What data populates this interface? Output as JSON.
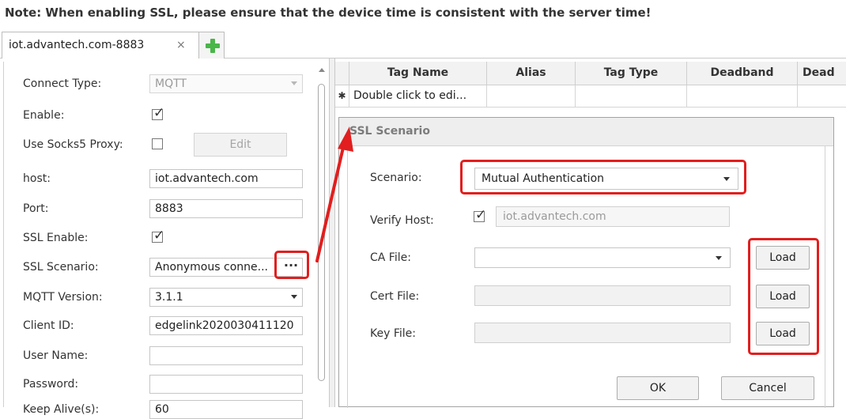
{
  "note": "Note: When enabling SSL, please ensure that the device time is consistent with the server time!",
  "tab": {
    "title": "iot.advantech.com-8883",
    "close_glyph": "×"
  },
  "left_panel": {
    "fields": [
      {
        "label": "Connect Type:",
        "value": "MQTT"
      },
      {
        "label": "Enable:",
        "checked": true
      },
      {
        "label": "Use Socks5 Proxy:",
        "checked": false,
        "button": "Edit"
      },
      {
        "label": "host:",
        "value": "iot.advantech.com"
      },
      {
        "label": "Port:",
        "value": "8883"
      },
      {
        "label": "SSL Enable:",
        "checked": true
      },
      {
        "label": "SSL Scenario:",
        "value": "Anonymous conne...",
        "button": "···"
      },
      {
        "label": "MQTT Version:",
        "value": "3.1.1"
      },
      {
        "label": "Client ID:",
        "value": "edgelink2020030411120"
      },
      {
        "label": "User Name:",
        "value": ""
      },
      {
        "label": "Password:",
        "value": ""
      },
      {
        "label": "Keep Alive(s):",
        "value": "60"
      }
    ]
  },
  "grid": {
    "columns": [
      "Tag Name",
      "Alias",
      "Tag Type",
      "Deadband",
      "Dead"
    ],
    "new_row_marker": "✱",
    "new_row_text": "Double click to edi..."
  },
  "dialog": {
    "title": "SSL Scenario",
    "scenario": {
      "label": "Scenario:",
      "value": "Mutual Authentication"
    },
    "verify_host": {
      "label": "Verify Host:",
      "checked": true,
      "value": "iot.advantech.com"
    },
    "ca_file": {
      "label": "CA File:",
      "value": "",
      "button": "Load"
    },
    "cert_file": {
      "label": "Cert File:",
      "value": "",
      "button": "Load"
    },
    "key_file": {
      "label": "Key File:",
      "value": "",
      "button": "Load"
    },
    "ok": "OK",
    "cancel": "Cancel"
  },
  "colors": {
    "highlight": "#e21e1e",
    "add_tab": "#49b649",
    "header_bg": "#f2f2f2"
  },
  "icons": {
    "add_tab": "plus-icon",
    "check": "checkmark-icon",
    "dropdown": "chevron-down-icon"
  }
}
